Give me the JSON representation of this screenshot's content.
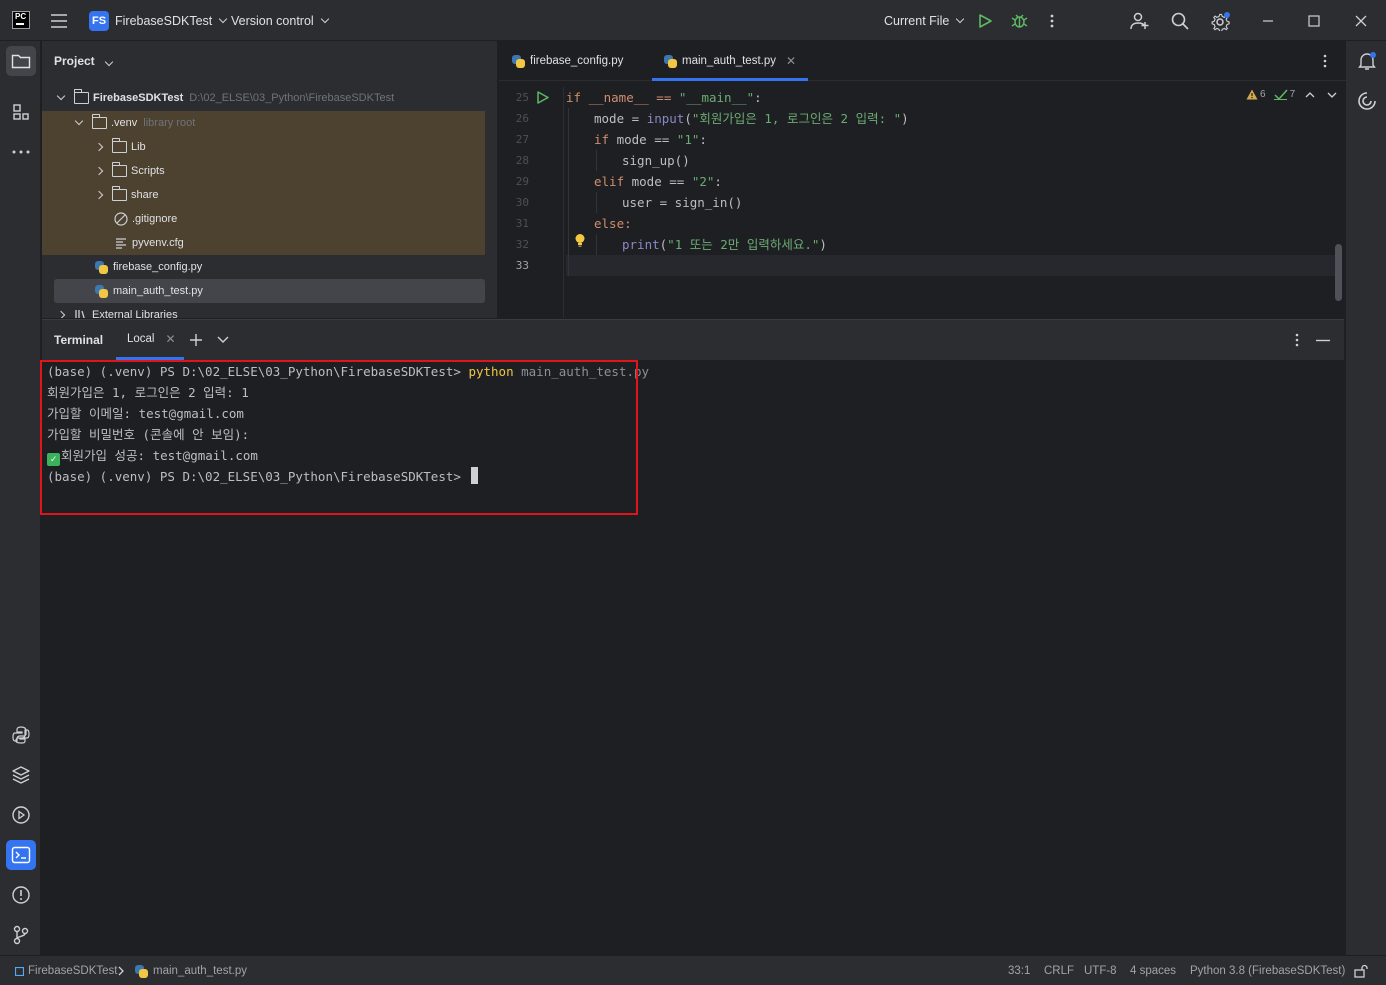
{
  "titlebar": {
    "app_logo": "PC",
    "project_badge": "FS",
    "project_name": "FirebaseSDKTest",
    "vcs": "Version control",
    "run_config": "Current File"
  },
  "project_panel": {
    "header": "Project",
    "tree": [
      {
        "label": "FirebaseSDKTest",
        "hint": "D:\\02_ELSE\\03_Python\\FirebaseSDKTest"
      },
      {
        "label": ".venv",
        "hint": "library root"
      },
      {
        "label": "Lib"
      },
      {
        "label": "Scripts"
      },
      {
        "label": "share"
      },
      {
        "label": ".gitignore"
      },
      {
        "label": "pyvenv.cfg"
      },
      {
        "label": "firebase_config.py"
      },
      {
        "label": "main_auth_test.py"
      },
      {
        "label": "External Libraries"
      }
    ]
  },
  "editor": {
    "tabs": [
      {
        "label": "firebase_config.py"
      },
      {
        "label": "main_auth_test.py"
      }
    ],
    "inspections": {
      "warnings": "6",
      "weak_warnings": "7"
    },
    "line_numbers": [
      "25",
      "26",
      "27",
      "28",
      "29",
      "30",
      "31",
      "32",
      "33"
    ],
    "code": {
      "l25_a": "if __name__ == ",
      "l25_b": "\"__main__\"",
      "l25_c": ":",
      "l26_a": "mode = ",
      "l26_b": "input",
      "l26_c": "(",
      "l26_d": "\"회원가입은 1, 로그인은 2 입력: \"",
      "l26_e": ")",
      "l27_a": "if",
      "l27_b": " mode == ",
      "l27_c": "\"1\"",
      "l27_d": ":",
      "l28": "sign_up()",
      "l29_a": "elif",
      "l29_b": " mode == ",
      "l29_c": "\"2\"",
      "l29_d": ":",
      "l30": "user = sign_in()",
      "l31": "else:",
      "l32_a": "print",
      "l32_b": "(",
      "l32_c": "\"1 또는 2만 입력하세요.\"",
      "l32_d": ")"
    }
  },
  "terminal": {
    "title": "Terminal",
    "tab": "Local",
    "lines": {
      "prompt1": "(base) (.venv) PS D:\\02_ELSE\\03_Python\\FirebaseSDKTest> ",
      "cmd": "python",
      "cmd_arg": " main_auth_test.py",
      "out1": "회원가입은 1, 로그인은 2 입력: 1",
      "out2": "가입할 이메일: test@gmail.com",
      "out3": "가입할 비밀번호 (콘솔에 안 보임):",
      "out4": "회원가입 성공: test@gmail.com",
      "prompt2": "(base) (.venv) PS D:\\02_ELSE\\03_Python\\FirebaseSDKTest> "
    }
  },
  "statusbar": {
    "project": "FirebaseSDKTest",
    "file": "main_auth_test.py",
    "position": "33:1",
    "line_sep": "CRLF",
    "encoding": "UTF-8",
    "indent": "4 spaces",
    "interpreter": "Python 3.8 (FirebaseSDKTest)"
  },
  "colors": {
    "accent": "#3574f0",
    "highlight_box": "#e0151b",
    "run_green": "#5fb865"
  }
}
